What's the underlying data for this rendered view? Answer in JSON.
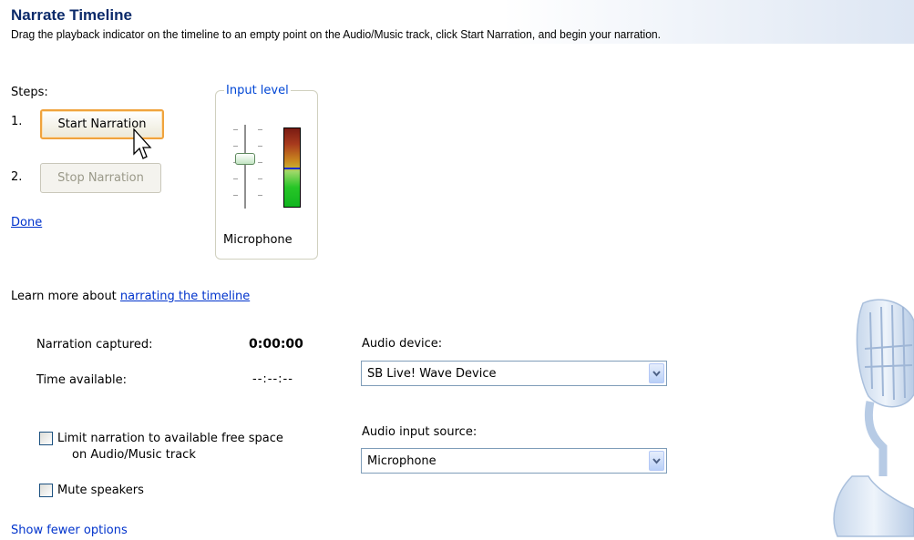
{
  "header": {
    "title": "Narrate Timeline",
    "instructions": "Drag the playback indicator on the timeline to an empty point on the Audio/Music track, click Start Narration, and begin your narration."
  },
  "steps": {
    "label": "Steps:",
    "step1_num": "1.",
    "step1_button": "Start Narration",
    "step2_num": "2.",
    "step2_button": "Stop Narration",
    "done_link": "Done"
  },
  "input_level": {
    "legend": "Input level",
    "source_label": "Microphone"
  },
  "learn_more": {
    "prefix": "Learn more about",
    "link": "narrating the timeline"
  },
  "stats": {
    "captured_label": "Narration captured:",
    "captured_value": "0:00:00",
    "available_label": "Time available:",
    "available_value": "--:--:--"
  },
  "options": {
    "limit_label_line1": "Limit narration to available free space",
    "limit_label_line2": "on Audio/Music track",
    "mute_label": "Mute speakers",
    "show_fewer": "Show fewer options"
  },
  "audio": {
    "device_label": "Audio device:",
    "device_value": "SB Live! Wave Device",
    "source_label": "Audio input source:",
    "source_value": "Microphone"
  },
  "icons": {
    "cursor": "arrow-cursor-icon",
    "dropdown": "chevron-down-icon",
    "microphone": "microphone-icon"
  },
  "colors": {
    "title": "#0b2a6a",
    "link": "#0033cc",
    "legend": "#0046d5",
    "active_button_border": "#f0a33d"
  }
}
